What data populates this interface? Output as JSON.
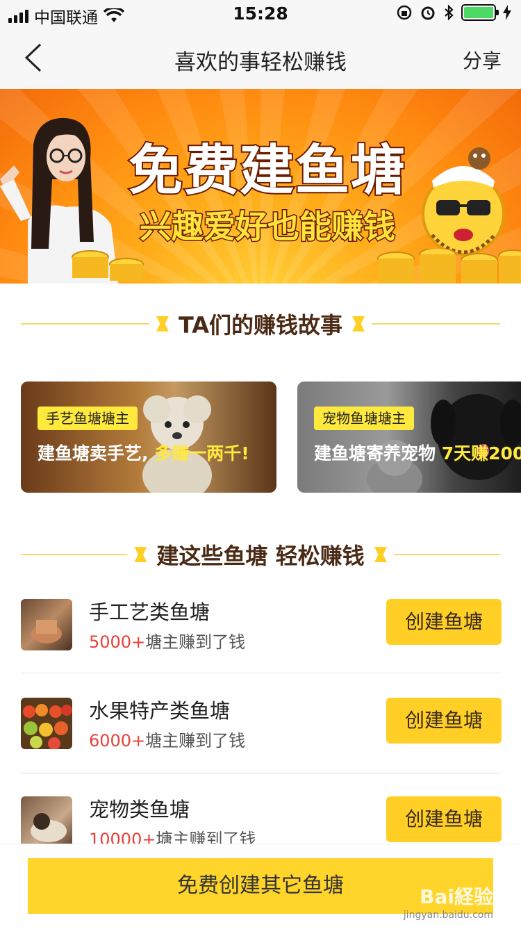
{
  "status_bar": {
    "carrier": "中国联通",
    "time": "15:28"
  },
  "nav": {
    "title": "喜欢的事轻松赚钱",
    "share_label": "分享"
  },
  "banner": {
    "title": "免费建鱼塘",
    "subtitle": "兴趣爱好也能赚钱"
  },
  "stories_section": {
    "title": "TA们的赚钱故事"
  },
  "stories": [
    {
      "tag": "手艺鱼塘塘主",
      "text": "建鱼塘卖手艺,",
      "highlight": "多赚一两千!"
    },
    {
      "tag": "宠物鱼塘塘主",
      "text": "建鱼塘寄养宠物",
      "highlight": "7天赚200"
    }
  ],
  "ponds_section": {
    "title": "建这些鱼塘 轻松赚钱"
  },
  "ponds": [
    {
      "name": "手工艺类鱼塘",
      "count": "5000+",
      "count_suffix": "塘主赚到了钱",
      "button": "创建鱼塘"
    },
    {
      "name": "水果特产类鱼塘",
      "count": "6000+",
      "count_suffix": "塘主赚到了钱",
      "button": "创建鱼塘"
    },
    {
      "name": "宠物类鱼塘",
      "count": "10000+",
      "count_suffix": "塘主赚到了钱",
      "button": "创建鱼塘"
    }
  ],
  "bottom": {
    "button": "免费创建其它鱼塘"
  },
  "watermark": {
    "main": "Bai経验",
    "sub": "jingyan.baidu.com"
  },
  "colors": {
    "accent": "#ffcf25",
    "highlight_red": "#e8403a",
    "banner_orange": "#ff8a10"
  }
}
